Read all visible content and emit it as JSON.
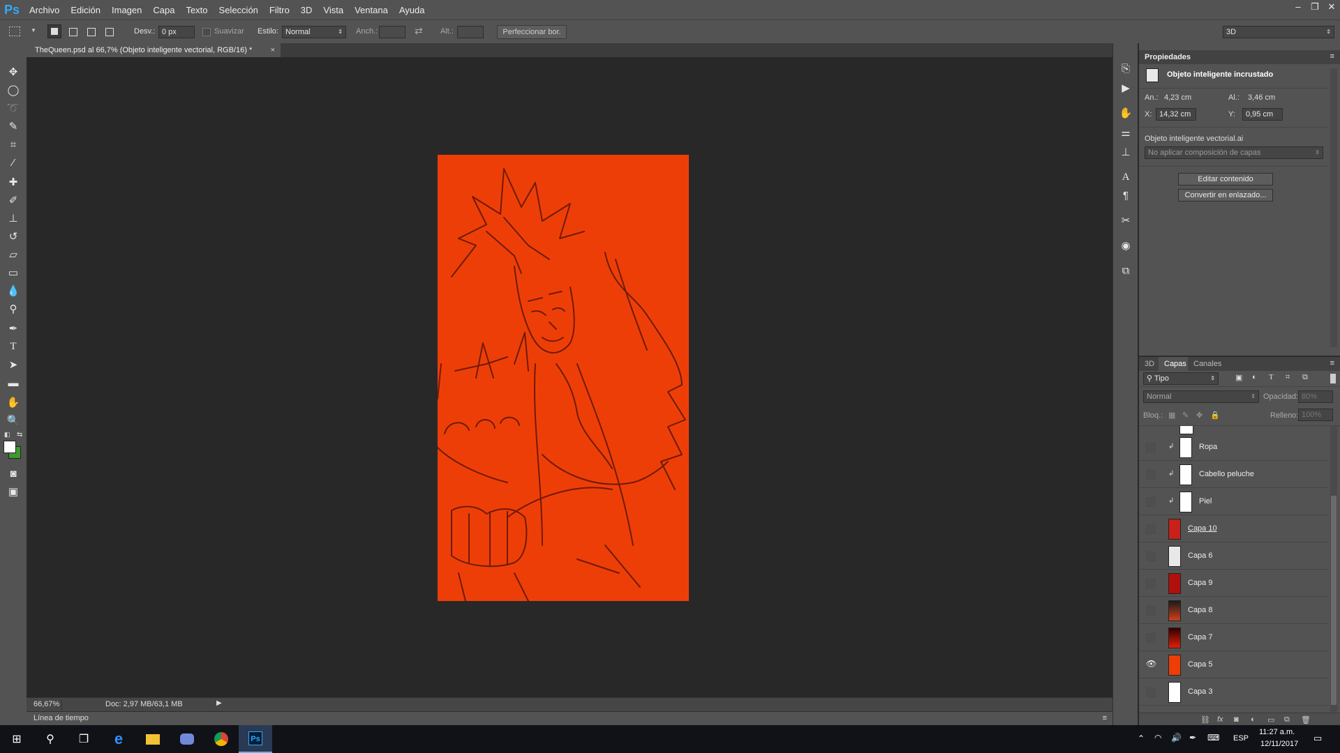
{
  "app": {
    "logo": "Ps"
  },
  "menu": [
    "Archivo",
    "Edición",
    "Imagen",
    "Capa",
    "Texto",
    "Selección",
    "Filtro",
    "3D",
    "Vista",
    "Ventana",
    "Ayuda"
  ],
  "window_controls": {
    "minimize": "–",
    "restore": "❐",
    "close": "✕"
  },
  "options": {
    "feather_label": "Desv.:",
    "feather_value": "0 px",
    "smooth_label": "Suavizar",
    "style_label": "Estilo:",
    "style_value": "Normal",
    "width_label": "Anch.:",
    "height_label": "Alt.:",
    "refine_button": "Perfeccionar bor.",
    "workspace_value": "3D"
  },
  "document": {
    "tab_title": "TheQueen.psd al 66,7% (Objeto inteligente vectorial, RGB/16) *",
    "close": "×",
    "canvas_color": "#ee3e08"
  },
  "status": {
    "zoom": "66,67%",
    "doc_size": "Doc: 2,97 MB/63,1 MB"
  },
  "timeline": {
    "label": "Línea de tiempo"
  },
  "properties": {
    "tab": "Propiedades",
    "object_type": "Objeto inteligente incrustado",
    "w_label": "An.:",
    "w_value": "4,23 cm",
    "h_label": "Al.:",
    "h_value": "3,46 cm",
    "x_label": "X:",
    "x_value": "14,32 cm",
    "y_label": "Y:",
    "y_value": "0,95 cm",
    "file_name": "Objeto inteligente vectorial.ai",
    "comp_select": "No aplicar composición de capas",
    "edit_button": "Editar contenido",
    "convert_button": "Convertir en enlazado..."
  },
  "layers_panel": {
    "tabs": [
      "3D",
      "Capas",
      "Canales"
    ],
    "active_tab": "Capas",
    "filter_label": "Tipo",
    "blend_mode": "Normal",
    "opacity_label": "Opacidad:",
    "opacity_value": "80%",
    "lock_label": "Bloq.:",
    "fill_label": "Relleno:",
    "fill_value": "100%",
    "layers": [
      {
        "name": "Ropa",
        "clipped": true,
        "visible": false,
        "thumb": "#ffffff"
      },
      {
        "name": "Cabello peluche",
        "clipped": true,
        "visible": false,
        "thumb": "#ffffff"
      },
      {
        "name": "Piel",
        "clipped": true,
        "visible": false,
        "thumb": "#ffffff"
      },
      {
        "name": "Capa 10",
        "clipped": false,
        "visible": false,
        "thumb": "#c8201a"
      },
      {
        "name": "Capa 6",
        "clipped": false,
        "visible": false,
        "thumb": "#e8e8e8"
      },
      {
        "name": "Capa 9",
        "clipped": false,
        "visible": false,
        "thumb": "#b0100c"
      },
      {
        "name": "Capa 8",
        "clipped": false,
        "visible": false,
        "thumb": "#4a1a10"
      },
      {
        "name": "Capa 7",
        "clipped": false,
        "visible": false,
        "thumb": "#d0200a"
      },
      {
        "name": "Capa 5",
        "clipped": false,
        "visible": true,
        "thumb": "#ee3e08"
      },
      {
        "name": "Capa 3",
        "clipped": false,
        "visible": false,
        "thumb": "#ffffff"
      }
    ]
  },
  "taskbar": {
    "lang": "ESP",
    "time": "11:27 a.m.",
    "date": "12/11/2017",
    "ps_label": "Ps"
  },
  "colors": {
    "foreground": "#ffffff",
    "background": "#3f9a2c",
    "accent": "#31a8ff"
  }
}
